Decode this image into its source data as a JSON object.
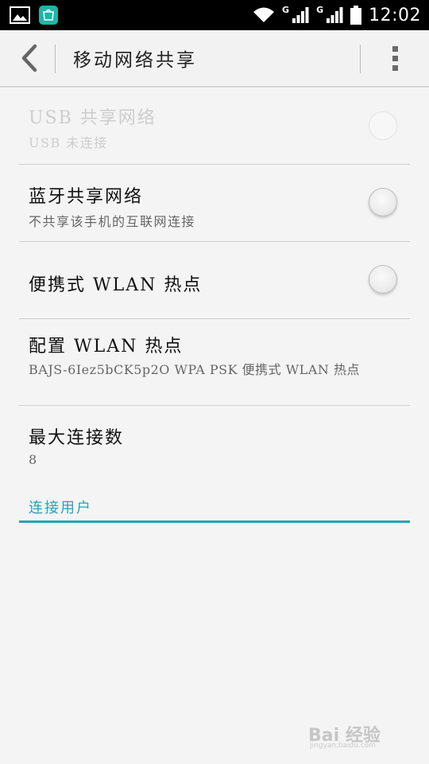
{
  "status_bar": {
    "time": "12:02",
    "sim1_network": "G",
    "sim2_network": "G",
    "icons": [
      "gallery-icon",
      "huawei-store-icon",
      "wifi-icon",
      "signal-icon",
      "signal-icon",
      "battery-icon"
    ]
  },
  "action_bar": {
    "title": "移动网络共享",
    "back_icon": "chevron-left-icon",
    "overflow_icon": "more-vert-icon"
  },
  "settings": [
    {
      "title": "USB 共享网络",
      "subtitle": "USB 未连接",
      "toggle": "off",
      "enabled": false
    },
    {
      "title": "蓝牙共享网络",
      "subtitle": "不共享该手机的互联网连接",
      "toggle": "off",
      "enabled": true
    },
    {
      "title": "便携式 WLAN 热点",
      "toggle": "off",
      "enabled": true
    },
    {
      "title": "配置 WLAN 热点",
      "subtitle": "BAJS-6Iez5bCK5p2O WPA PSK 便携式 WLAN 热点",
      "enabled": true
    },
    {
      "title": "最大连接数",
      "subtitle": "8",
      "enabled": true
    }
  ],
  "section": {
    "label": "连接用户"
  },
  "watermark": {
    "text": "Bai 经验",
    "sub": "jingyan.baidu.com"
  },
  "colors": {
    "accent": "#2aa1b8",
    "status_bar": "#000000",
    "background": "#f4f4f4"
  }
}
